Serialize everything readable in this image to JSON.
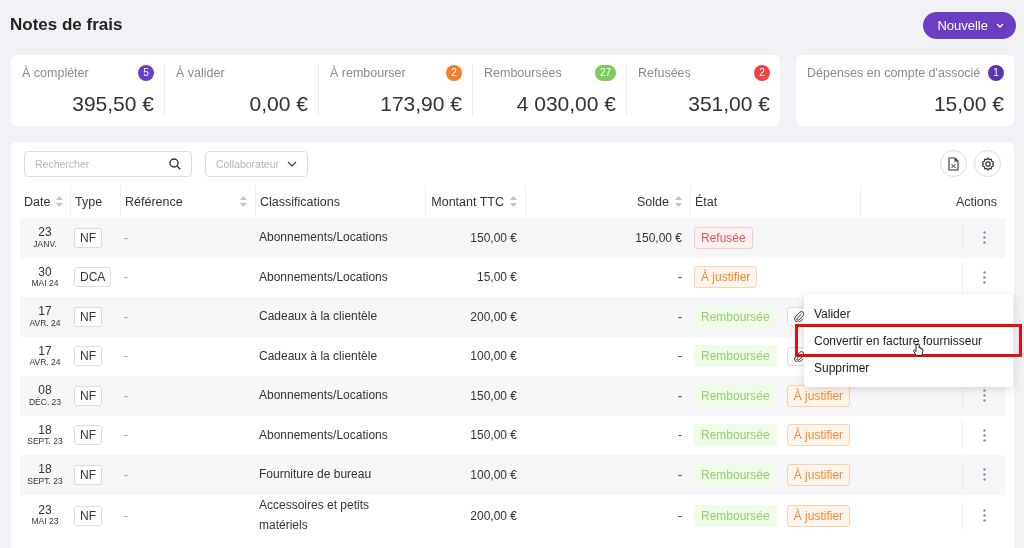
{
  "header": {
    "title": "Notes de frais",
    "new_button": "Nouvelle"
  },
  "stats": [
    {
      "label": "À compléter",
      "count": "5",
      "color": "#6a3fc4",
      "amount": "395,50 €"
    },
    {
      "label": "À valider",
      "amount": "0,00 €"
    },
    {
      "label": "À rembourser",
      "count": "2",
      "color": "#f47f2a",
      "amount": "173,90 €"
    },
    {
      "label": "Remboursées",
      "count": "27",
      "color": "#7ccb5c",
      "amount": "4 030,00 €"
    },
    {
      "label": "Refusées",
      "count": "2",
      "color": "#ef4444",
      "amount": "351,00 €"
    }
  ],
  "associate_card": {
    "label": "Dépenses en compte d'associé",
    "count": "1",
    "color": "#5b35b5",
    "amount": "15,00 €"
  },
  "toolbar": {
    "search_placeholder": "Rechercher",
    "collaborator_placeholder": "Collaborateur"
  },
  "table": {
    "columns": [
      {
        "label": "Date",
        "sortable": true
      },
      {
        "label": "Type",
        "sortable": false
      },
      {
        "label": "Référence",
        "sortable": true
      },
      {
        "label": "Classifications",
        "sortable": false
      },
      {
        "label": "Montant TTC",
        "sortable": true
      },
      {
        "label": "Solde",
        "sortable": true
      },
      {
        "label": "État",
        "sortable": false
      },
      {
        "label": "Actions",
        "sortable": false
      }
    ],
    "rows": [
      {
        "day": "23",
        "month": "JANV.",
        "type": "NF",
        "reference": "-",
        "classification": "Abonnements/Locations",
        "amount": "150,00 €",
        "balance": "150,00 €",
        "tags": [
          {
            "label": "Refusée",
            "kind": "refused"
          }
        ],
        "attachment": false
      },
      {
        "day": "30",
        "month": "MAI 24",
        "type": "DCA",
        "reference": "-",
        "classification": "Abonnements/Locations",
        "amount": "15,00 €",
        "balance": "-",
        "tags": [
          {
            "label": "À justifier",
            "kind": "to_justify"
          }
        ],
        "attachment": false
      },
      {
        "day": "17",
        "month": "AVR. 24",
        "type": "NF",
        "reference": "-",
        "classification": "Cadeaux à la clientèle",
        "amount": "200,00 €",
        "balance": "-",
        "tags": [
          {
            "label": "Remboursée",
            "kind": "reimbursed"
          }
        ],
        "attachment": true
      },
      {
        "day": "17",
        "month": "AVR. 24",
        "type": "NF",
        "reference": "-",
        "classification": "Cadeaux à la clientèle",
        "amount": "100,00 €",
        "balance": "-",
        "tags": [
          {
            "label": "Remboursée",
            "kind": "reimbursed"
          }
        ],
        "attachment": true
      },
      {
        "day": "08",
        "month": "DÉC. 23",
        "type": "NF",
        "reference": "-",
        "classification": "Abonnements/Locations",
        "amount": "150,00 €",
        "balance": "-",
        "tags": [
          {
            "label": "Remboursée",
            "kind": "reimbursed"
          },
          {
            "label": "À justifier",
            "kind": "to_justify"
          }
        ],
        "attachment": false
      },
      {
        "day": "18",
        "month": "SEPT. 23",
        "type": "NF",
        "reference": "-",
        "classification": "Abonnements/Locations",
        "amount": "150,00 €",
        "balance": "-",
        "tags": [
          {
            "label": "Remboursée",
            "kind": "reimbursed"
          },
          {
            "label": "À justifier",
            "kind": "to_justify"
          }
        ],
        "attachment": false
      },
      {
        "day": "18",
        "month": "SEPT. 23",
        "type": "NF",
        "reference": "-",
        "classification": "Fourniture de bureau",
        "amount": "100,00 €",
        "balance": "-",
        "tags": [
          {
            "label": "Remboursée",
            "kind": "reimbursed"
          },
          {
            "label": "À justifier",
            "kind": "to_justify"
          }
        ],
        "attachment": false
      },
      {
        "day": "23",
        "month": "MAI 23",
        "type": "NF",
        "reference": "-",
        "classification": "Accessoires et petits matériels",
        "amount": "200,00 €",
        "balance": "-",
        "tags": [
          {
            "label": "Remboursée",
            "kind": "reimbursed"
          },
          {
            "label": "À justifier",
            "kind": "to_justify"
          }
        ],
        "attachment": false
      }
    ]
  },
  "context_menu": {
    "items": [
      {
        "label": "Valider",
        "highlighted": false
      },
      {
        "label": "Convertir en facture fournisseur",
        "highlighted": true
      },
      {
        "label": "Supprimer",
        "highlighted": false
      }
    ]
  }
}
